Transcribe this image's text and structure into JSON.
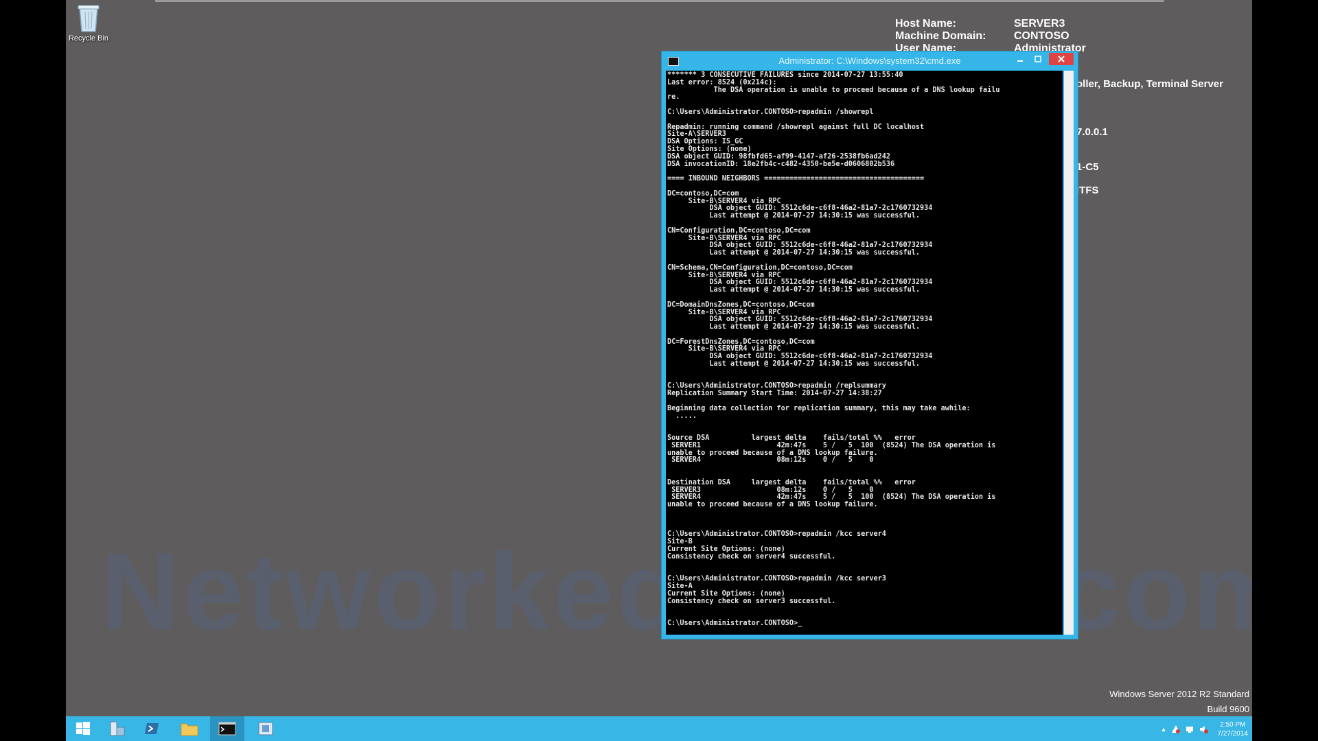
{
  "desktop": {
    "recycle_bin_label": "Recycle Bin",
    "watermark": "Networkedblinds.com",
    "bginfo": {
      "rows": [
        {
          "key": "Host Name:",
          "value": "SERVER3"
        },
        {
          "key": "Machine Domain:",
          "value": "CONTOSO"
        },
        {
          "key": "User Name:",
          "value": "Administrator"
        }
      ],
      "right_fragments": [
        "oller, Backup, Terminal Server",
        "7.0.0.1",
        "1-C5",
        "ITFS"
      ]
    },
    "os_name": "Windows Server 2012 R2 Standard",
    "os_build": "Build 9600"
  },
  "taskbar": {
    "items": [
      "start",
      "server-manager",
      "powershell",
      "file-explorer",
      "command-prompt",
      "ad-tool"
    ],
    "clock_time": "2:50 PM",
    "clock_date": "7/27/2014"
  },
  "cmd_window": {
    "title": "Administrator: C:\\Windows\\system32\\cmd.exe",
    "lines": [
      "******* 3 CONSECUTIVE FAILURES since 2014-07-27 13:55:40",
      "Last error: 8524 (0x214c):",
      "           The DSA operation is unable to proceed because of a DNS lookup failu",
      "re.",
      "",
      "C:\\Users\\Administrator.CONTOSO>repadmin /showrepl",
      "",
      "Repadmin: running command /showrepl against full DC localhost",
      "Site-A\\SERVER3",
      "DSA Options: IS_GC",
      "Site Options: (none)",
      "DSA object GUID: 98fbfd65-af99-4147-af26-2538fb6ad242",
      "DSA invocationID: 18e2fb4c-c482-4350-be5e-d0606802b536",
      "",
      "==== INBOUND NEIGHBORS ======================================",
      "",
      "DC=contoso,DC=com",
      "     Site-B\\SERVER4 via RPC",
      "          DSA object GUID: 5512c6de-c6f8-46a2-81a7-2c1760732934",
      "          Last attempt @ 2014-07-27 14:30:15 was successful.",
      "",
      "CN=Configuration,DC=contoso,DC=com",
      "     Site-B\\SERVER4 via RPC",
      "          DSA object GUID: 5512c6de-c6f8-46a2-81a7-2c1760732934",
      "          Last attempt @ 2014-07-27 14:30:15 was successful.",
      "",
      "CN=Schema,CN=Configuration,DC=contoso,DC=com",
      "     Site-B\\SERVER4 via RPC",
      "          DSA object GUID: 5512c6de-c6f8-46a2-81a7-2c1760732934",
      "          Last attempt @ 2014-07-27 14:30:15 was successful.",
      "",
      "DC=DomainDnsZones,DC=contoso,DC=com",
      "     Site-B\\SERVER4 via RPC",
      "          DSA object GUID: 5512c6de-c6f8-46a2-81a7-2c1760732934",
      "          Last attempt @ 2014-07-27 14:30:15 was successful.",
      "",
      "DC=ForestDnsZones,DC=contoso,DC=com",
      "     Site-B\\SERVER4 via RPC",
      "          DSA object GUID: 5512c6de-c6f8-46a2-81a7-2c1760732934",
      "          Last attempt @ 2014-07-27 14:30:15 was successful.",
      "",
      "",
      "C:\\Users\\Administrator.CONTOSO>repadmin /replsummary",
      "Replication Summary Start Time: 2014-07-27 14:38:27",
      "",
      "Beginning data collection for replication summary, this may take awhile:",
      "  .....",
      "",
      "",
      "Source DSA          largest delta    fails/total %%   error",
      " SERVER1                  42m:47s    5 /   5  100  (8524) The DSA operation is",
      "unable to proceed because of a DNS lookup failure.",
      " SERVER4                  08m:12s    0 /   5    0",
      "",
      "",
      "Destination DSA     largest delta    fails/total %%   error",
      " SERVER3                  08m:12s    0 /   5    0",
      " SERVER4                  42m:47s    5 /   5  100  (8524) The DSA operation is",
      "unable to proceed because of a DNS lookup failure.",
      "",
      "",
      "",
      "C:\\Users\\Administrator.CONTOSO>repadmin /kcc server4",
      "Site-B",
      "Current Site Options: (none)",
      "Consistency check on server4 successful.",
      "",
      "",
      "C:\\Users\\Administrator.CONTOSO>repadmin /kcc server3",
      "Site-A",
      "Current Site Options: (none)",
      "Consistency check on server3 successful.",
      "",
      "",
      "C:\\Users\\Administrator.CONTOSO>_"
    ]
  },
  "colors": {
    "desktop": "#5f5c5d",
    "taskbar": "#38b6e5",
    "window_frame": "#35b5e8",
    "close_button": "#e04343"
  }
}
